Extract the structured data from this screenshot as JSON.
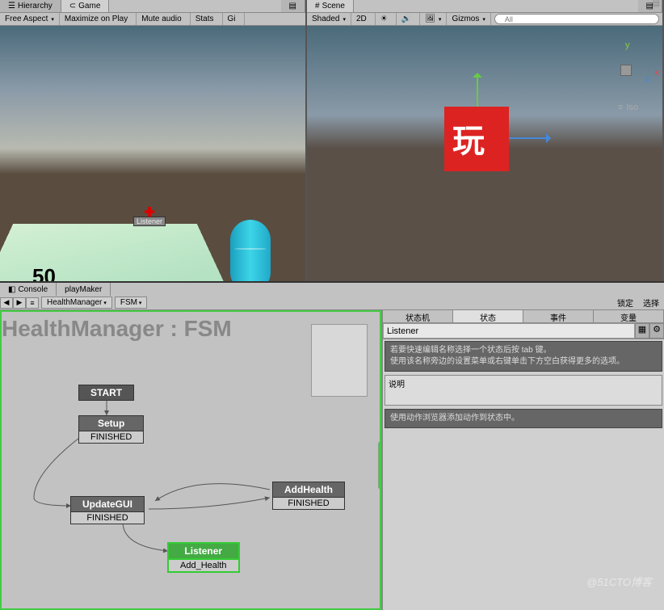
{
  "left_tabs": {
    "hierarchy": "Hierarchy",
    "game": "Game"
  },
  "game_toolbar": {
    "aspect": "Free Aspect",
    "maximize": "Maximize on Play",
    "mute": "Mute audio",
    "stats": "Stats",
    "gizmo": "Gi"
  },
  "game_view": {
    "score": "50",
    "listener_label": "Listener"
  },
  "right_tabs": {
    "scene": "Scene"
  },
  "scene_toolbar": {
    "shaded": "Shaded",
    "mode_2d": "2D",
    "gizmos": "Gizmos",
    "search_ph": "All"
  },
  "scene_view": {
    "iso": "Iso",
    "ax": "x",
    "ay": "y",
    "az": "z"
  },
  "bottom_tabs": {
    "console": "Console",
    "playmaker": "playMaker"
  },
  "pm_toolbar": {
    "manager": "HealthManager",
    "fsm": "FSM",
    "lock": "锁定",
    "select": "选择"
  },
  "canvas": {
    "title": "HealthManager : FSM",
    "nodes": {
      "start": "START",
      "setup": {
        "name": "Setup",
        "event": "FINISHED"
      },
      "updategui": {
        "name": "UpdateGUI",
        "event": "FINISHED"
      },
      "addhealth": {
        "name": "AddHealth",
        "event": "FINISHED"
      },
      "listener": {
        "name": "Listener",
        "event": "Add_Health"
      }
    }
  },
  "inspector": {
    "tabs": {
      "fsm": "状态机",
      "state": "状态",
      "events": "事件",
      "vars": "变量"
    },
    "name": "Listener",
    "hint": "若要快速编辑名称选择一个状态后按 tab 键。\n使用该名称旁边的设置菜单或右键单击下方空白获得更多的选项。",
    "desc_label": "说明",
    "action_hint": "使用动作浏览器添加动作到状态中。"
  },
  "watermark": "@51CTO博客"
}
